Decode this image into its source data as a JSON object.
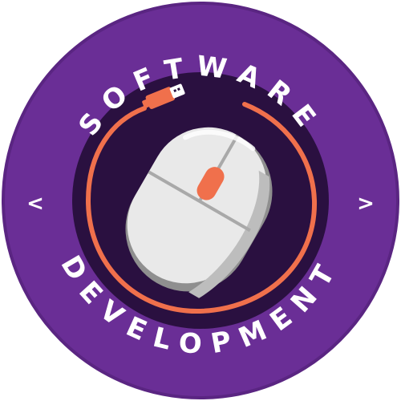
{
  "badge": {
    "top_text": "SOFTWARE",
    "bottom_text": "DEVELOPMENT",
    "left_chevron": "<",
    "right_chevron": ">"
  },
  "colors": {
    "outer_purple": "#6a2e96",
    "inner_dark": "#2a1040",
    "ring_border": "#4a1f6e",
    "accent_orange": "#f0704c",
    "mouse_body": "#e9e9e9",
    "mouse_shadow": "#9e9e9e",
    "text": "#ffffff"
  },
  "icons": {
    "center": "computer-mouse-icon",
    "connector": "usb-plug-icon"
  }
}
